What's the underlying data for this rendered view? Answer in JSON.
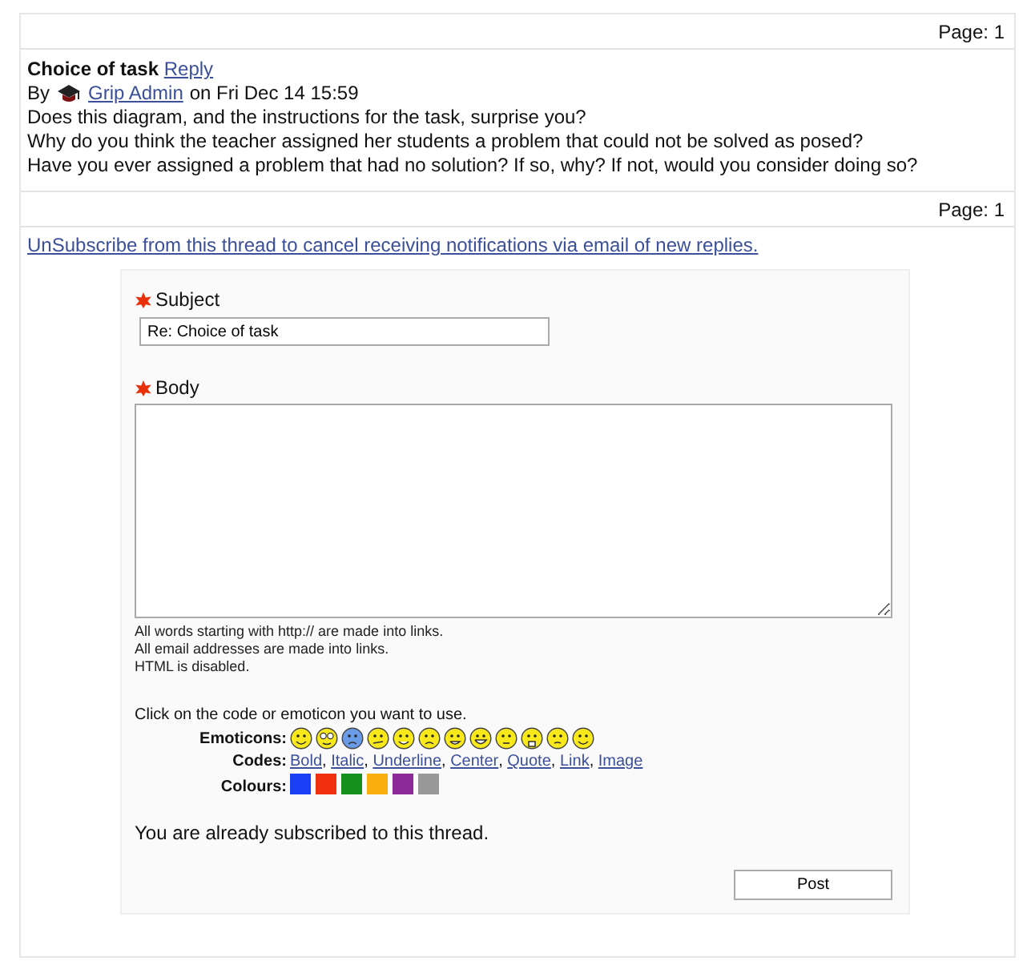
{
  "pager_top": "Page: 1",
  "post": {
    "title": "Choice of task",
    "reply_link": "Reply",
    "by": "By",
    "author": "Grip Admin",
    "date": "on Fri Dec 14 15:59",
    "lines": [
      "Does this diagram, and the instructions for the task, surprise you?",
      "Why do you think the teacher assigned her students a problem that could not be solved as posed?",
      "Have you ever assigned a problem that had no solution? If so, why? If not, would you consider doing so?"
    ]
  },
  "pager_bottom": "Page: 1",
  "unsubscribe_link": "UnSubscribe from this thread to cancel receiving notifications via email of new replies.",
  "form": {
    "subject_label": "Subject",
    "subject_value": "Re: Choice of task",
    "body_label": "Body",
    "hints": [
      "All words starting with http:// are made into links.",
      "All email addresses are made into links.",
      "HTML is disabled."
    ],
    "instruction": "Click on the code or emoticon you want to use.",
    "emoticons_label": "Emoticons:",
    "codes_label": "Codes:",
    "codes": [
      "Bold",
      "Italic",
      "Underline",
      "Center",
      "Quote",
      "Link",
      "Image"
    ],
    "code_separator": ",",
    "colours_label": "Colours:",
    "colours": [
      {
        "color": "#1a3ff5"
      },
      {
        "color": "#f0300f"
      },
      {
        "color": "#14901c"
      },
      {
        "color": "#f8ae0c"
      },
      {
        "color": "#8e2a98"
      },
      {
        "color": "#999999"
      }
    ],
    "subscribed_note": "You are already subscribed to this thread.",
    "post_button": "Post"
  }
}
